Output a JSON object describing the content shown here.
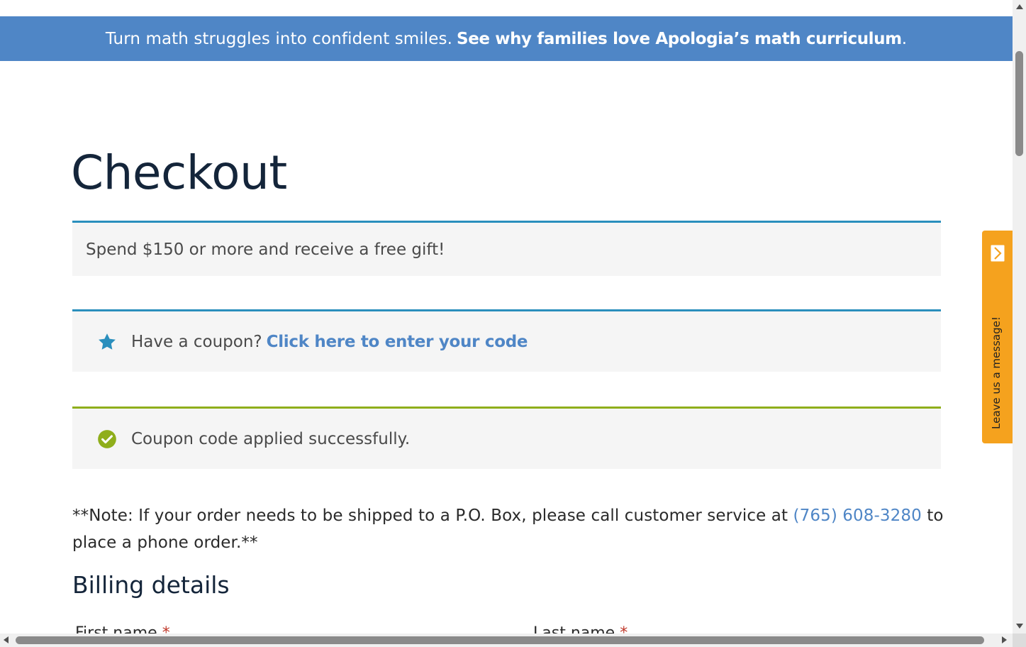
{
  "promo": {
    "text": "Turn math struggles into confident smiles.",
    "link_label": "See why families love Apologia’s math curriculum",
    "suffix": "."
  },
  "page_title": "Checkout",
  "notices": {
    "gift": "Spend $150 or more and receive a free gift!",
    "coupon_prompt": "Have a coupon?",
    "coupon_link": "Click here to enter your code",
    "coupon_icon": "star-icon",
    "success": "Coupon code applied successfully.",
    "success_icon": "check-circle-icon"
  },
  "shipping_note": {
    "before": "**Note: If your order needs to be shipped to a P.O. Box, please call customer service at",
    "phone": "(765) 608-3280",
    "after": "to place a phone order.**"
  },
  "billing": {
    "heading": "Billing details",
    "first_name_label": "First name",
    "last_name_label": "Last name",
    "required_marker": "*"
  },
  "message_tab": {
    "label": "Leave us a message!",
    "icon": "chevron-right-icon"
  },
  "colors": {
    "promo_bar": "#4f86c6",
    "link": "#4f86c6",
    "info_border": "#2a8fbd",
    "success_border": "#8fae1b",
    "message_tab": "#f5a21e",
    "heading": "#14253a"
  }
}
